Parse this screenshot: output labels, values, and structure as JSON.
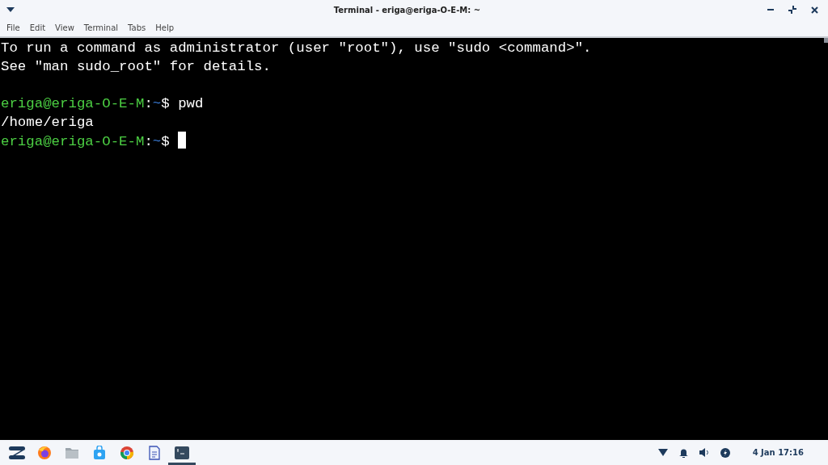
{
  "window": {
    "title": "Terminal - eriga@eriga-O-E-M: ~"
  },
  "menu": [
    "File",
    "Edit",
    "View",
    "Terminal",
    "Tabs",
    "Help"
  ],
  "terminal": {
    "lines": [
      {
        "kind": "text",
        "text": "To run a command as administrator (user \"root\"), use \"sudo <command>\"."
      },
      {
        "kind": "text",
        "text": "See \"man sudo_root\" for details."
      },
      {
        "kind": "blank"
      },
      {
        "kind": "prompt",
        "user": "eriga@eriga-O-E-M",
        "sep": ":",
        "path": "~",
        "symbol": "$",
        "command": "pwd"
      },
      {
        "kind": "text",
        "text": "/home/eriga"
      },
      {
        "kind": "prompt",
        "user": "eriga@eriga-O-E-M",
        "sep": ":",
        "path": "~",
        "symbol": "$",
        "cursor": true
      }
    ]
  },
  "taskbar": {
    "apps": [
      {
        "kind": "menu",
        "selected": false
      },
      {
        "kind": "browser",
        "selected": false
      },
      {
        "kind": "files",
        "selected": false
      },
      {
        "kind": "store",
        "selected": false
      },
      {
        "kind": "chrome",
        "selected": false
      },
      {
        "kind": "document",
        "selected": false
      },
      {
        "kind": "terminal",
        "selected": true
      }
    ],
    "clock": "4 Jan 17:16"
  }
}
